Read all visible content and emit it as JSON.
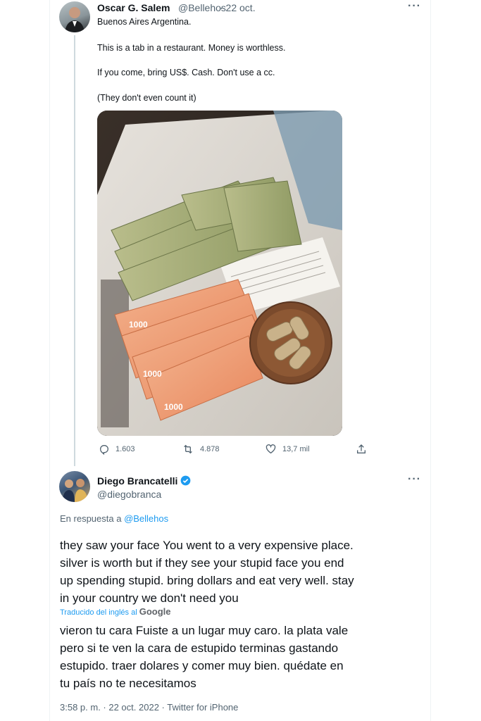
{
  "tweet1": {
    "name": "Oscar G. Salem",
    "handle": "@Bellehos",
    "date": "· 22 oct.",
    "more": "···",
    "lines": [
      "Buenos Aires Argentina.",
      "This is a tab in a restaurant.  Money is worthless.",
      "If you come, bring US$.  Cash.  Don't use a cc.",
      "(They don't even count it)"
    ],
    "photo_note_numbers": [
      "1000",
      "1000",
      "1000"
    ],
    "actions": {
      "replies": "1.603",
      "retweets": "4.878",
      "likes": "13,7 mil"
    }
  },
  "tweet2": {
    "name": "Diego Brancatelli",
    "handle": "@diegobranca",
    "more": "···",
    "reply_prefix": "En respuesta a ",
    "reply_to": "@Bellehos",
    "text_en": [
      "they saw your face You went to a very expensive place.",
      "silver is worth but if they see your stupid face you end",
      "up spending stupid. bring dollars and eat very well. stay",
      "in your country we don't need you"
    ],
    "translated_by": "Traducido del inglés al",
    "google": "Google",
    "text_es": [
      "vieron tu cara Fuiste a un lugar muy caro. la plata vale",
      "pero si te ven la cara de estupido terminas gastando",
      "estupido. traer dolares y comer muy bien. quédate en",
      "tu país no te necesitamos"
    ],
    "meta": "3:58 p. m. · 22 oct. 2022 · Twitter for iPhone"
  },
  "colors": {
    "accent": "#1d9bf0",
    "muted": "#536471",
    "text": "#0f1419"
  },
  "icons": [
    "reply-icon",
    "retweet-icon",
    "like-icon",
    "share-icon",
    "verified-badge-icon",
    "more-icon"
  ]
}
